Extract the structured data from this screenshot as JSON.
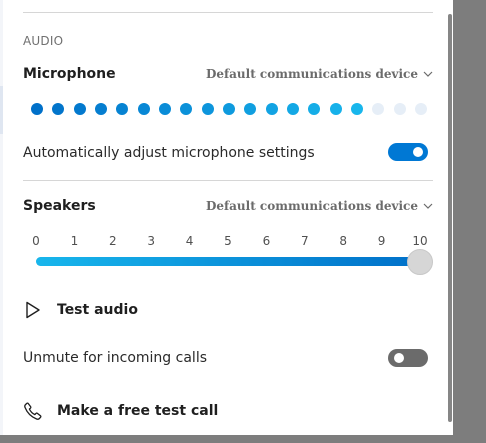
{
  "audio": {
    "section_label": "AUDIO",
    "microphone": {
      "title": "Microphone",
      "device": "Default communications device",
      "level": {
        "total": 19,
        "active": 16
      },
      "auto_adjust_label": "Automatically adjust microphone settings",
      "auto_adjust_on": true
    },
    "speakers": {
      "title": "Speakers",
      "device": "Default communications device",
      "ticks": [
        "0",
        "1",
        "2",
        "3",
        "4",
        "5",
        "6",
        "7",
        "8",
        "9",
        "10"
      ],
      "volume": 10,
      "volume_max": 10,
      "test_audio_label": "Test audio"
    },
    "unmute": {
      "label": "Unmute for incoming calls",
      "on": false
    },
    "test_call_label": "Make a free test call"
  },
  "colors": {
    "accent": "#0078d4",
    "toggle_off": "#6b6b6b",
    "dot_inactive": "#e6eef7"
  },
  "icons": {
    "chevron": "chevron-down-icon",
    "play": "play-icon",
    "phone": "phone-icon"
  }
}
